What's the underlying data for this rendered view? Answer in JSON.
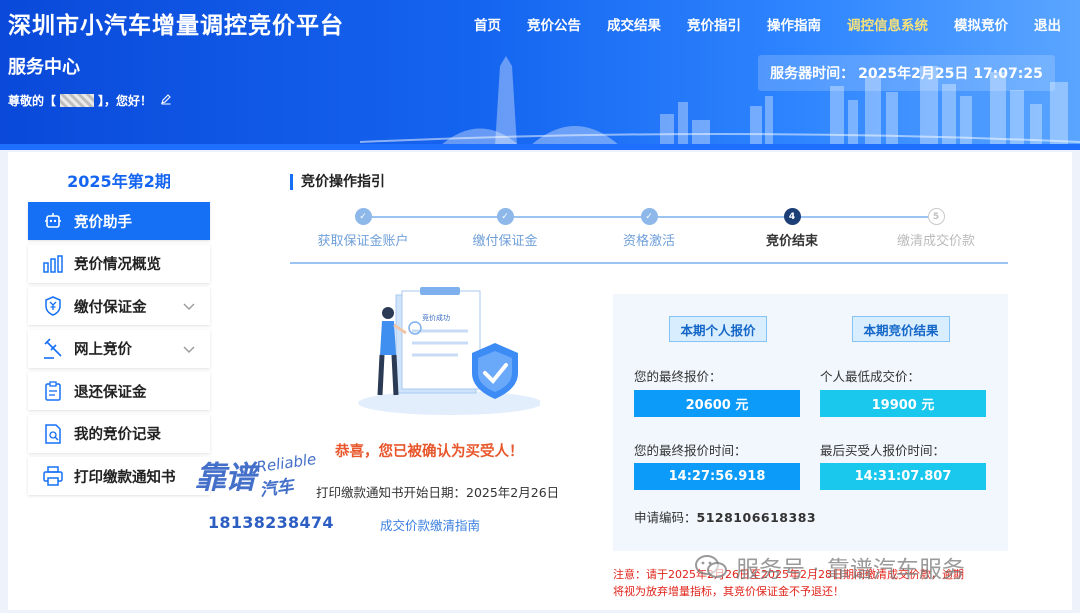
{
  "header": {
    "title": "深圳市小汽车增量调控竞价平台",
    "nav": [
      "首页",
      "竞价公告",
      "成交结果",
      "竞价指引",
      "操作指南",
      "调控信息系统",
      "模拟竞价",
      "退出"
    ],
    "nav_active_index": 5,
    "service_center": "服务中心",
    "greeting_prefix": "尊敬的【",
    "greeting_suffix": "】，您好！",
    "server_time_label": "服务器时间：",
    "server_time": "2025年2月25日 17:07:25"
  },
  "sidebar": {
    "period": "2025年第2期",
    "items": [
      {
        "label": "竞价助手",
        "icon": "robot-icon",
        "active": true
      },
      {
        "label": "竞价情况概览",
        "icon": "bar-chart-icon"
      },
      {
        "label": "缴付保证金",
        "icon": "shield-yen-icon",
        "expandable": true
      },
      {
        "label": "网上竞价",
        "icon": "gavel-icon",
        "expandable": true
      },
      {
        "label": "退还保证金",
        "icon": "clipboard-icon"
      },
      {
        "label": "我的竞价记录",
        "icon": "document-search-icon"
      },
      {
        "label": "打印缴款通知书",
        "icon": "printer-icon"
      }
    ]
  },
  "guide": {
    "title": "竞价操作指引",
    "steps": [
      {
        "label": "获取保证金账户",
        "state": "done",
        "num": "✓"
      },
      {
        "label": "缴付保证金",
        "state": "done",
        "num": "✓"
      },
      {
        "label": "资格激活",
        "state": "done",
        "num": "✓"
      },
      {
        "label": "竞价结束",
        "state": "current",
        "num": "4"
      },
      {
        "label": "缴清成交价款",
        "state": "todo",
        "num": "5"
      }
    ]
  },
  "success": {
    "illustration_text": "竞价成功",
    "congrats": "恭喜，您已被确认为买受人！",
    "print_start": "打印缴款通知书开始日期：2025年2月26日",
    "guide_link": "成交价款缴清指南"
  },
  "result": {
    "personal_tag": "本期个人报价",
    "result_tag": "本期竞价结果",
    "final_bid_label": "您的最终报价：",
    "final_bid": "20600 元",
    "lowest_deal_label": "个人最低成交价：",
    "lowest_deal": "19900 元",
    "final_bid_time_label": "您的最终报价时间：",
    "final_bid_time": "14:27:56.918",
    "last_buyer_time_label": "最后买受人报价时间：",
    "last_buyer_time": "14:31:07.807",
    "app_code_label": "申请编码：",
    "app_code": "5128106618383"
  },
  "notice": {
    "line1": "注意：请于2025年2月26日至2025年2月28日期间缴清成交价款，逾期",
    "line2": "将视为放弃增量指标，其竞价保证金不予退还！"
  },
  "watermarks": {
    "brand_big": "靠谱",
    "brand_en": "Reliable",
    "brand_cn": "汽车",
    "phone": "18138238474",
    "wechat": "服务号 · 靠谱汽车服务"
  },
  "colors": {
    "header_blue": "#1565f0",
    "active_menu": "#1570f5",
    "nav_active": "#f7e27a",
    "congrats": "#e8572b",
    "notice": "#e0231a",
    "bid_value": "#0c9bf8",
    "result_value": "#19c8ec"
  }
}
